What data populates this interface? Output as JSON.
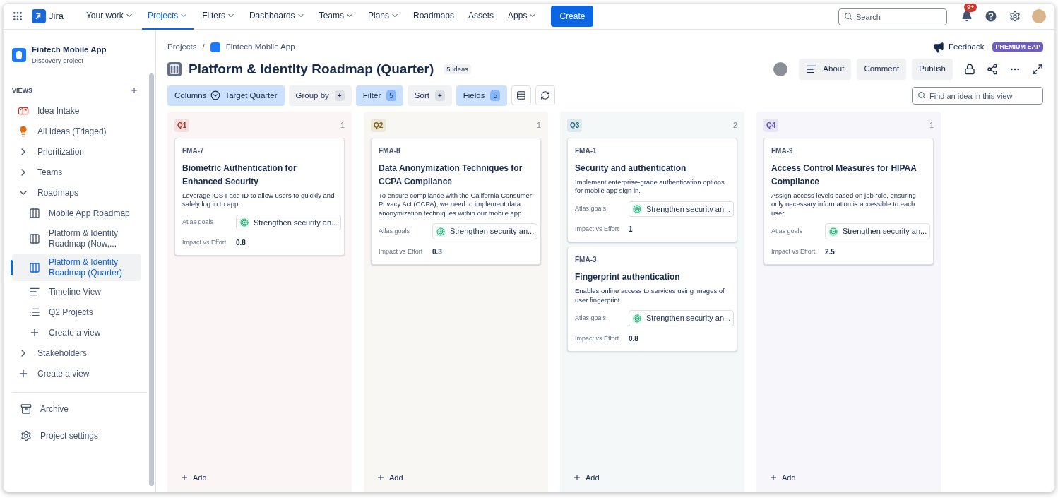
{
  "nav": {
    "product": "Jira",
    "items": [
      {
        "label": "Your work",
        "dropdown": true,
        "selected": false
      },
      {
        "label": "Projects",
        "dropdown": true,
        "selected": true
      },
      {
        "label": "Filters",
        "dropdown": true,
        "selected": false
      },
      {
        "label": "Dashboards",
        "dropdown": true,
        "selected": false
      },
      {
        "label": "Teams",
        "dropdown": true,
        "selected": false
      },
      {
        "label": "Plans",
        "dropdown": true,
        "selected": false
      },
      {
        "label": "Roadmaps",
        "dropdown": false,
        "selected": false
      },
      {
        "label": "Assets",
        "dropdown": false,
        "selected": false
      },
      {
        "label": "Apps",
        "dropdown": true,
        "selected": false
      }
    ],
    "create": "Create",
    "search": {
      "placeholder": "Search"
    },
    "notifications": "9+"
  },
  "sidebar": {
    "project": "Fintech Mobile App",
    "project_type": "Discovery project",
    "views_label": "VIEWS",
    "items": [
      {
        "kind": "intake",
        "label": "Idea Intake",
        "selected": false
      },
      {
        "kind": "idea",
        "label": "All Ideas (Triaged)",
        "selected": false
      },
      {
        "kind": "group",
        "label": "Prioritization",
        "expanded": false,
        "selected": false
      },
      {
        "kind": "group",
        "label": "Teams",
        "expanded": false,
        "selected": false
      },
      {
        "kind": "group",
        "label": "Roadmaps",
        "expanded": true,
        "selected": false,
        "children": [
          {
            "kind": "board",
            "label": "Mobile App Roadmap",
            "selected": false
          },
          {
            "kind": "board",
            "label": "Platform & Identity Roadmap (Now,...",
            "selected": false
          },
          {
            "kind": "board",
            "label": "Platform & Identity Roadmap (Quarter)",
            "selected": true
          },
          {
            "kind": "timeline",
            "label": "Timeline View",
            "selected": false
          },
          {
            "kind": "list",
            "label": "Q2 Projects",
            "selected": false
          },
          {
            "kind": "create",
            "label": "Create a view",
            "selected": false
          }
        ]
      },
      {
        "kind": "group",
        "label": "Stakeholders",
        "expanded": false,
        "selected": false
      },
      {
        "kind": "create",
        "label": "Create a view",
        "selected": false
      }
    ],
    "footer": [
      {
        "kind": "archive",
        "label": "Archive"
      },
      {
        "kind": "settings",
        "label": "Project settings"
      }
    ]
  },
  "header": {
    "breadcrumb": [
      "Projects",
      "Fintech Mobile App"
    ],
    "breadcrumb_separator": "/",
    "feedback": "Feedback",
    "plan_badge": "PREMIUM EAP",
    "title": "Platform & Identity Roadmap (Quarter)",
    "count": "5 ideas",
    "actions": [
      "About",
      "Comment",
      "Publish"
    ]
  },
  "toolbar": {
    "columns": {
      "label": "Columns",
      "value": "Target Quarter"
    },
    "items": [
      {
        "label": "Group by",
        "count": "+",
        "active": false
      },
      {
        "label": "Filter",
        "count": "5",
        "active": true
      },
      {
        "label": "Sort",
        "count": "+",
        "active": false
      },
      {
        "label": "Fields",
        "count": "5",
        "active": true
      }
    ],
    "search": {
      "placeholder": "Find an idea in this view"
    }
  },
  "columns": [
    {
      "label": "Q1",
      "count": "1",
      "color": "#ae2e24",
      "add": "Add",
      "cards": [
        {
          "key": "FMA-7",
          "title": "Biometric Authentication for Enhanced Security",
          "description": "Leverage iOS Face ID to allow users to quickly and safely log in to app.",
          "goals_label": "Atlas goals",
          "goal": "Strengthen security an...",
          "impact_label": "Impact vs Effort",
          "impact": "0.8"
        }
      ]
    },
    {
      "label": "Q2",
      "count": "1",
      "color": "#7f5f01",
      "add": "Add",
      "cards": [
        {
          "key": "FMA-8",
          "title": "Data Anonymization Techniques for CCPA Compliance",
          "description": "To ensure compliance with the California Consumer Privacy Act (CCPA), we need to implement data anonymization techniques within our mobile app",
          "goals_label": "Atlas goals",
          "goal": "Strengthen security an...",
          "impact_label": "Impact vs Effort",
          "impact": "0.3"
        }
      ]
    },
    {
      "label": "Q3",
      "count": "2",
      "color": "#206a83",
      "add": "Add",
      "cards": [
        {
          "key": "FMA-1",
          "title": "Security and authentication",
          "description": "Implement enterprise-grade authentication options for mobile app sign in.",
          "goals_label": "Atlas goals",
          "goal": "Strengthen security an...",
          "impact_label": "Impact vs Effort",
          "impact": "1"
        },
        {
          "key": "FMA-3",
          "title": "Fingerprint authentication",
          "description": "Enables online access to services using images of user fingerprint.",
          "goals_label": "Atlas goals",
          "goal": "Strengthen security an...",
          "impact_label": "Impact vs Effort",
          "impact": "0.8"
        }
      ]
    },
    {
      "label": "Q4",
      "count": "1",
      "color": "#5e4db2",
      "add": "Add",
      "cards": [
        {
          "key": "FMA-9",
          "title": "Access Control Measures for HIPAA Compliance",
          "description": "Assign access levels based on job role, ensuring only necessary information is accessible to each user",
          "goals_label": "Atlas goals",
          "goal": "Strengthen security an...",
          "impact_label": "Impact vs Effort",
          "impact": "2.5"
        }
      ]
    }
  ]
}
